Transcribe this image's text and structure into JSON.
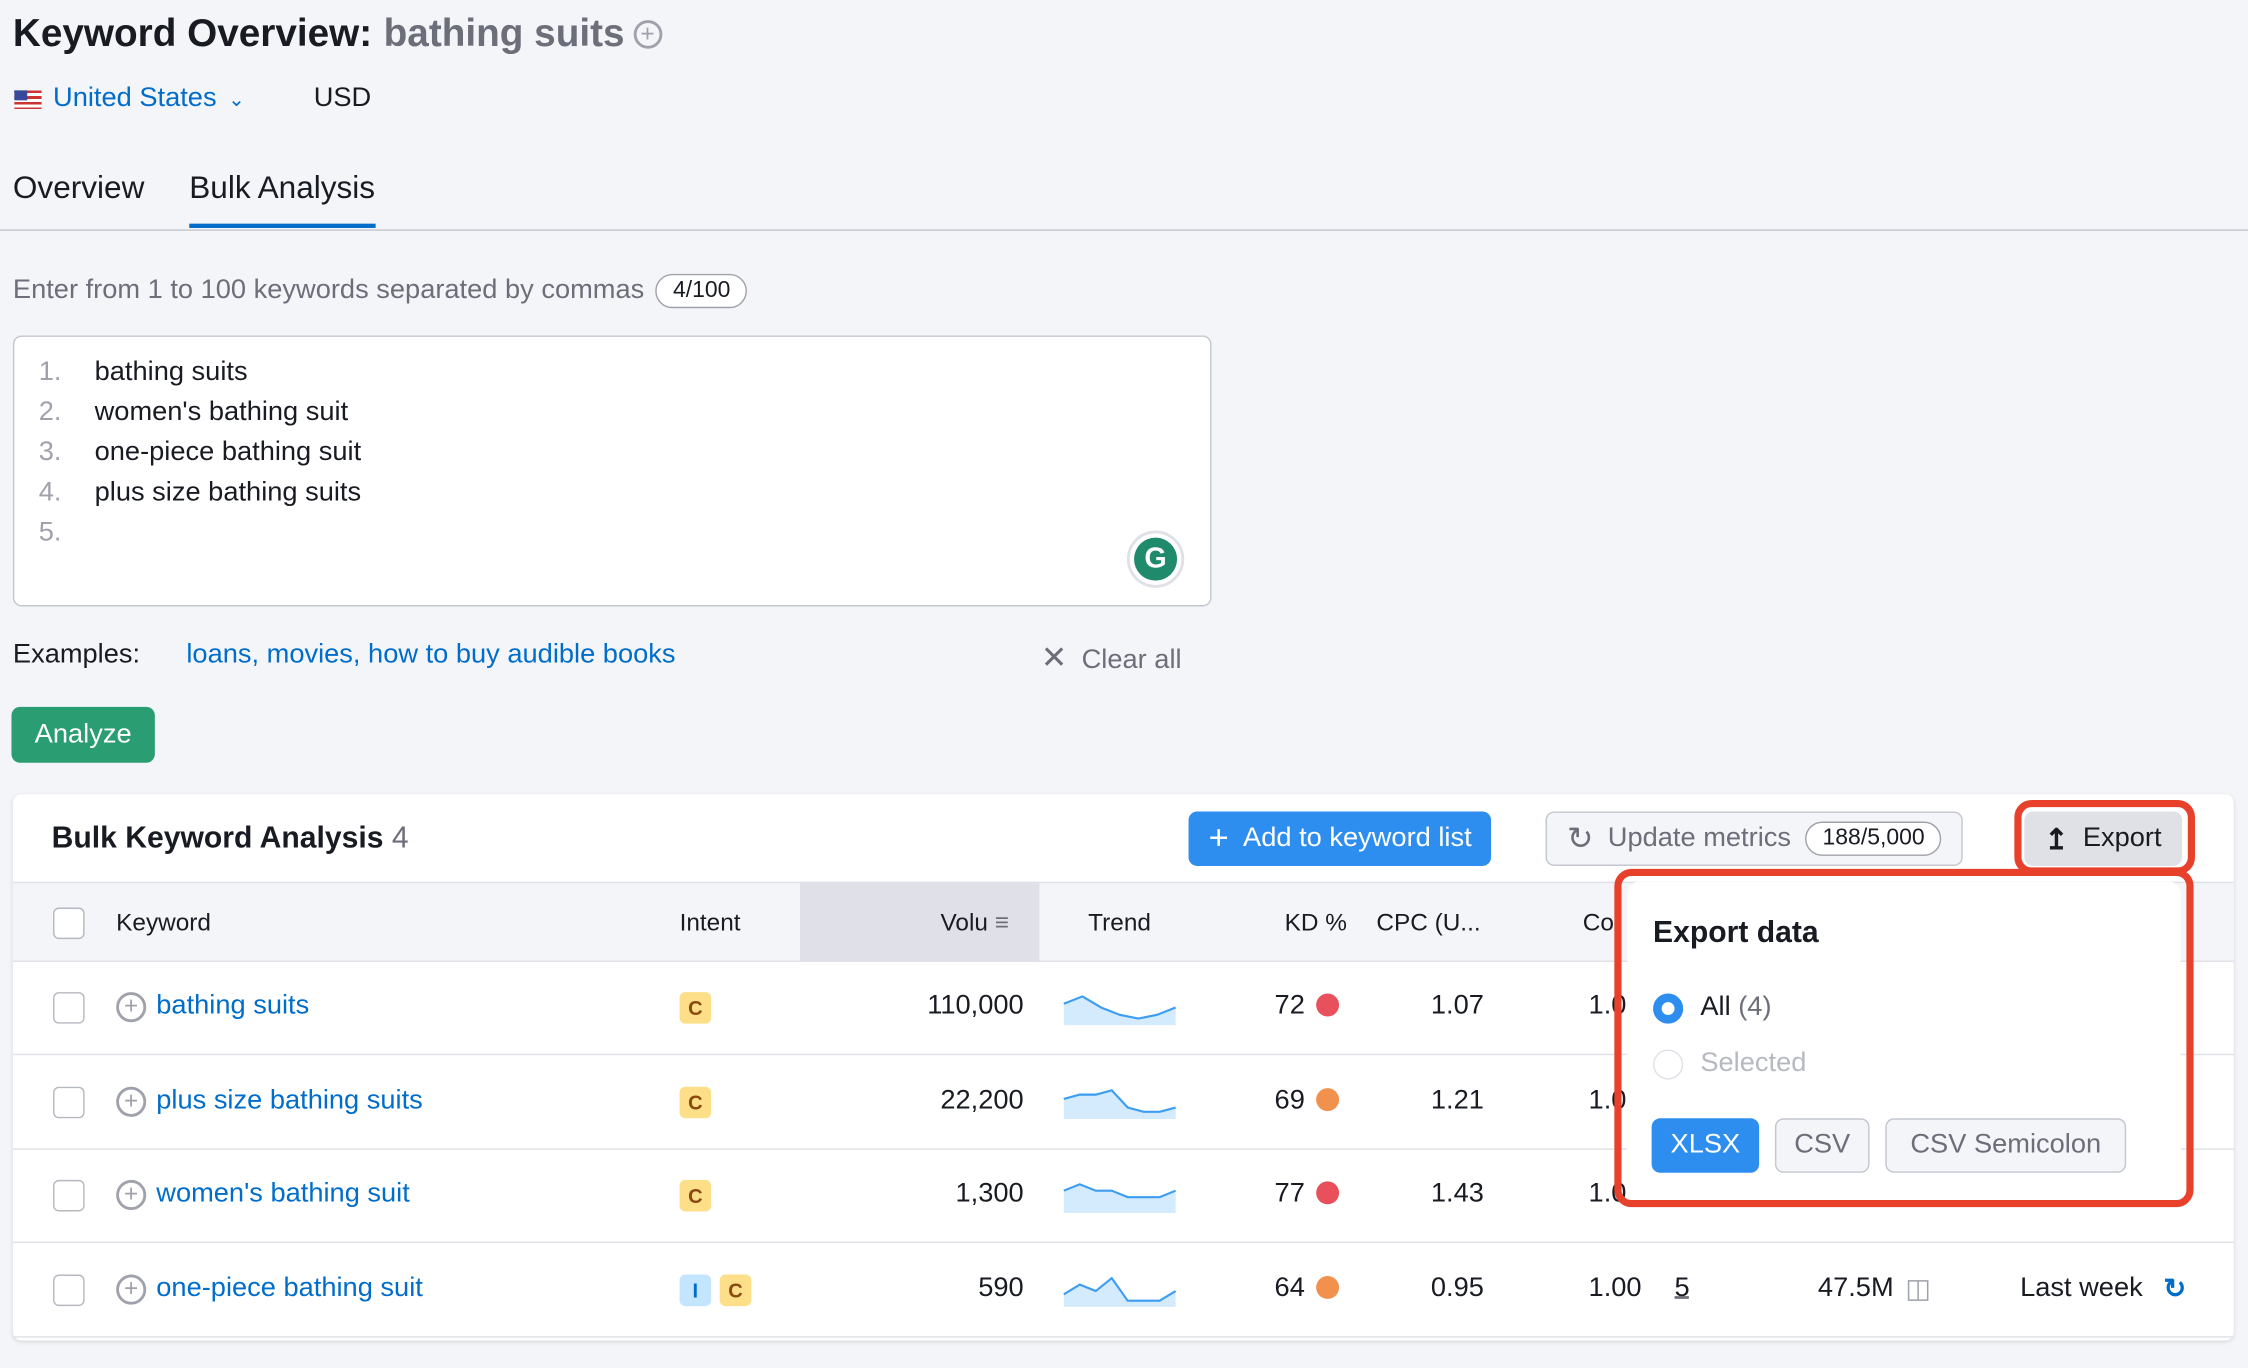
{
  "header": {
    "title": "Keyword Overview:",
    "keyword": "bathing suits",
    "country": "United States",
    "currency": "USD"
  },
  "tabs": [
    {
      "label": "Overview"
    },
    {
      "label": "Bulk Analysis",
      "active": true
    }
  ],
  "input": {
    "hint": "Enter from 1 to 100 keywords separated by commas",
    "count": "4/100",
    "lines": [
      {
        "n": "1.",
        "text": "bathing suits"
      },
      {
        "n": "2.",
        "text": "women's bathing suit"
      },
      {
        "n": "3.",
        "text": "one-piece bathing suit"
      },
      {
        "n": "4.",
        "text": "plus size bathing suits"
      },
      {
        "n": "5.",
        "text": ""
      }
    ],
    "grammarly": "G"
  },
  "examples": {
    "label": "Examples:",
    "links": "loans, movies, how to buy audible books",
    "clear": "Clear all"
  },
  "analyze": "Analyze",
  "table": {
    "title": "Bulk Keyword Analysis",
    "count": "4",
    "add_label": "Add to keyword list",
    "update_label": "Update metrics",
    "update_count": "188/5,000",
    "export_label": "Export",
    "columns": {
      "keyword": "Keyword",
      "intent": "Intent",
      "volume": "Volu",
      "trend": "Trend",
      "kd": "KD %",
      "cpc": "CPC (U...",
      "com": "Co"
    },
    "rows": [
      {
        "keyword": "bathing suits",
        "intents": [
          "C"
        ],
        "volume": "110,000",
        "kd": "72",
        "kd_color": "#e8505b",
        "cpc": "1.07",
        "com": "1.0",
        "trend": [
          5,
          7,
          4,
          2,
          1,
          2,
          4
        ]
      },
      {
        "keyword": "plus size bathing suits",
        "intents": [
          "C"
        ],
        "volume": "22,200",
        "kd": "69",
        "kd_color": "#f2904d",
        "cpc": "1.21",
        "com": "1.0",
        "trend": [
          4,
          5,
          5,
          6,
          2,
          1,
          1,
          2
        ]
      },
      {
        "keyword": "women's bathing suit",
        "intents": [
          "C"
        ],
        "volume": "1,300",
        "kd": "77",
        "kd_color": "#e8505b",
        "cpc": "1.43",
        "com": "1.0",
        "trend": [
          3,
          4,
          3,
          3,
          2,
          2,
          2,
          3
        ]
      },
      {
        "keyword": "one-piece bathing suit",
        "intents": [
          "I",
          "C"
        ],
        "volume": "590",
        "kd": "64",
        "kd_color": "#f2904d",
        "cpc": "0.95",
        "com": "1.00",
        "sf": "5",
        "results": "47.5M",
        "updated": "Last week",
        "trend": [
          3,
          6,
          4,
          8,
          1,
          1,
          1,
          4
        ]
      }
    ]
  },
  "export_popup": {
    "title": "Export data",
    "options": [
      {
        "label": "All",
        "count": "(4)",
        "selected": true
      },
      {
        "label": "Selected",
        "disabled": true
      }
    ],
    "formats": [
      "XLSX",
      "CSV",
      "CSV Semicolon"
    ],
    "active_format": "XLSX"
  },
  "colors": {
    "accent": "#2e8ef0",
    "link": "#006dca",
    "analyze": "#2a9d73",
    "highlight": "#e8412b"
  }
}
